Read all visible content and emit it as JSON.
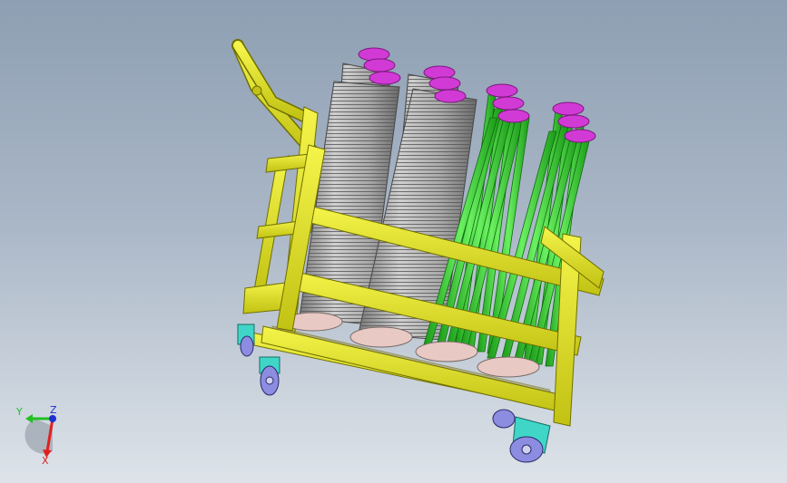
{
  "scene": {
    "background_top": "#8e9fb3",
    "background_bottom": "#dde3e9",
    "frame_color": "#e6e61f",
    "frame_edge": "#6f6f00",
    "coil_color": "#b5b5b5",
    "cap_color": "#d23ad6",
    "rod_color": "#33d62b",
    "wheel_color": "#8c8ce0",
    "caster_color": "#3fd6c8",
    "base_pad_color": "#e8c9c4"
  },
  "triad": {
    "x_label": "X",
    "y_label": "Y",
    "z_label": "Z",
    "x_color": "#e02020",
    "y_color": "#22c022",
    "z_color": "#2030d0"
  }
}
